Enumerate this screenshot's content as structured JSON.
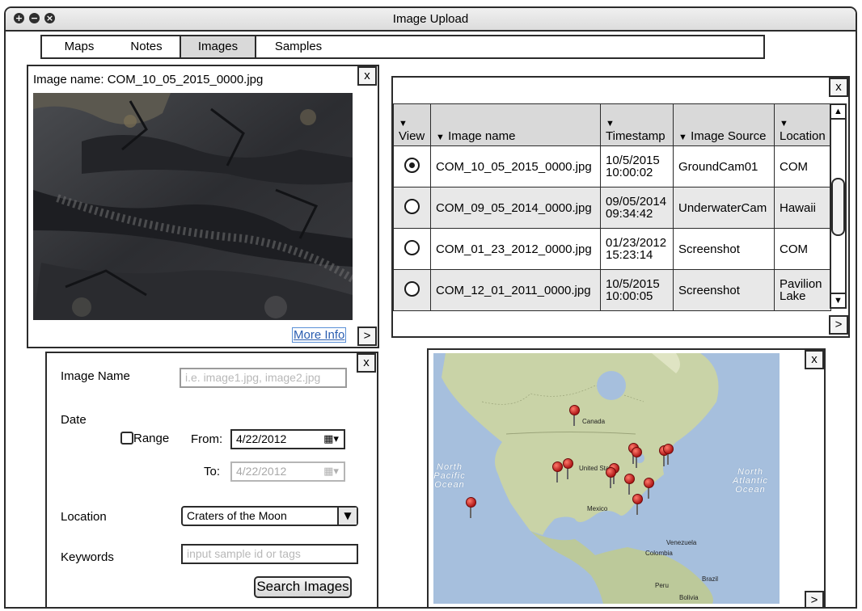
{
  "window": {
    "title": "Image Upload",
    "controls": [
      "add-icon",
      "minimize-icon",
      "close-icon"
    ]
  },
  "tabs": [
    {
      "label": "Maps",
      "active": false
    },
    {
      "label": "Notes",
      "active": false
    },
    {
      "label": "Images",
      "active": true
    },
    {
      "label": "Samples",
      "active": false
    }
  ],
  "image_panel": {
    "image_name_label": "Image name: COM_10_05_2015_0000.jpg",
    "more_info": "More Info",
    "close": "x",
    "next": ">"
  },
  "results_table": {
    "close": "x",
    "next": ">",
    "columns": [
      {
        "arrow": "▼",
        "label": "View"
      },
      {
        "arrow": "▼",
        "label": "Image name"
      },
      {
        "arrow": "▼",
        "label": "Timestamp"
      },
      {
        "arrow": "▼",
        "label": "Image Source"
      },
      {
        "arrow": "▼",
        "label": "Location"
      }
    ],
    "rows": [
      {
        "selected": true,
        "name": "COM_10_05_2015_0000.jpg",
        "date": "10/5/2015",
        "time": "10:00:02",
        "source": "GroundCam01",
        "loc1": "COM",
        "loc2": ""
      },
      {
        "selected": false,
        "name": "COM_09_05_2014_0000.jpg",
        "date": "09/05/2014",
        "time": "09:34:42",
        "source": "UnderwaterCam",
        "loc1": "Hawaii",
        "loc2": ""
      },
      {
        "selected": false,
        "name": "COM_01_23_2012_0000.jpg",
        "date": "01/23/2012",
        "time": "15:23:14",
        "source": "Screenshot",
        "loc1": "COM",
        "loc2": ""
      },
      {
        "selected": false,
        "name": "COM_12_01_2011_0000.jpg",
        "date": "10/5/2015",
        "time": "10:00:05",
        "source": "Screenshot",
        "loc1": "Pavilion",
        "loc2": "Lake"
      }
    ],
    "scroll_up": "▲",
    "scroll_down": "▼"
  },
  "search_form": {
    "close": "x",
    "image_name_label": "Image Name",
    "image_name_placeholder": "i.e. image1.jpg, image2.jpg",
    "date_label": "Date",
    "range_label": "Range",
    "from_label": "From:",
    "from_value": "4/22/2012",
    "to_label": "To:",
    "to_value": "4/22/2012",
    "location_label": "Location",
    "location_value": "Craters of the Moon",
    "keywords_label": "Keywords",
    "keywords_placeholder": "input sample id or tags",
    "search_button": "Search Images"
  },
  "map_panel": {
    "close": "x",
    "next": ">",
    "labels": {
      "canada": "Canada",
      "united_states": "United States",
      "mexico": "Mexico",
      "venezuela": "Venezuela",
      "colombia": "Colombia",
      "brazil": "Brazil",
      "peru": "Peru",
      "bolivia": "Bolivia",
      "north_pacific_1": "North",
      "north_pacific_2": "Pacific",
      "north_pacific_3": "Ocean",
      "north_atlantic_1": "North",
      "north_atlantic_2": "Atlantic",
      "north_atlantic_3": "Ocean"
    }
  },
  "colors": {
    "border": "#2b2b2b",
    "header_bg": "#d9d9d9",
    "alt_row": "#e8e8e8",
    "ocean": "#a6bfdd",
    "land": "#c9d3a7",
    "link": "#2a5db0",
    "pin": "#c91f1f"
  }
}
